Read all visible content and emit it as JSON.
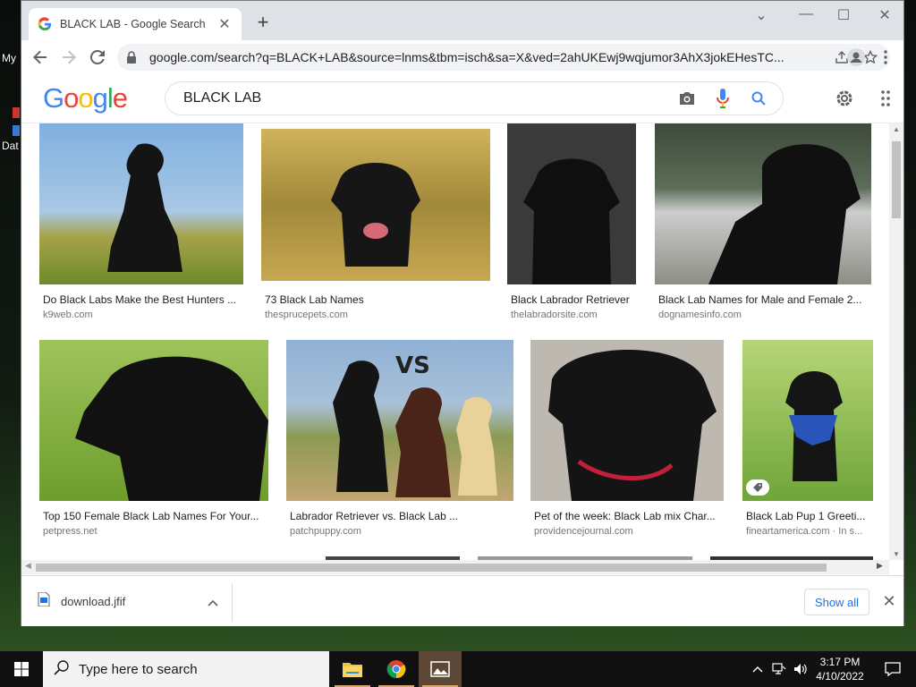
{
  "desktop": {
    "icons": [
      {
        "label": "My"
      },
      {
        "label": "Dat"
      }
    ]
  },
  "browser": {
    "tab": {
      "title": "BLACK LAB - Google Search",
      "favicon": "google-g-icon"
    },
    "new_tab_symbol": "+",
    "window_controls": {
      "minimize": "—",
      "maximize": "☐",
      "close": "✕",
      "dropdown": "⌄"
    },
    "url": "google.com/search?q=BLACK+LAB&source=lnms&tbm=isch&sa=X&ved=2ahUKEwj9wqjumor3AhX3jokEHesTC..."
  },
  "google": {
    "logo_letters": [
      "G",
      "o",
      "o",
      "g",
      "l",
      "e"
    ],
    "logo_colors": [
      "#4285f4",
      "#ea4335",
      "#fbbc05",
      "#4285f4",
      "#34a853",
      "#ea4335"
    ],
    "query": "BLACK LAB"
  },
  "results": [
    {
      "caption": "Do Black Labs Make the Best Hunters ...",
      "source": "k9web.com",
      "bg": "#8fb6d9"
    },
    {
      "caption": "73 Black Lab Names",
      "source": "thesprucepets.com",
      "bg": "#b59a4a"
    },
    {
      "caption": "Black Labrador Retriever",
      "source": "thelabradorsite.com",
      "bg": "#3a3a3a"
    },
    {
      "caption": "Black Lab Names for Male and Female 2...",
      "source": "dognamesinfo.com",
      "bg": "#6d7a6a"
    },
    {
      "caption": "Top 150 Female Black Lab Names For Your...",
      "source": "petpress.net",
      "bg": "#7dab3d"
    },
    {
      "caption": "Labrador Retriever vs. Black Lab ...",
      "source": "patchpuppy.com",
      "bg": "#8fa7c0",
      "overlay_text": "VS"
    },
    {
      "caption": "Pet of the week: Black Lab mix Char...",
      "source": "providencejournal.com",
      "bg": "#bdb8b0"
    },
    {
      "caption": "Black Lab Pup 1 Greeti...",
      "source": "fineartamerica.com · In s...",
      "bg": "#7fae45"
    }
  ],
  "downloads": {
    "file_name": "download.jfif",
    "show_all_label": "Show all"
  },
  "taskbar": {
    "search_placeholder": "Type here to search",
    "time": "3:17 PM",
    "date": "4/10/2022"
  }
}
